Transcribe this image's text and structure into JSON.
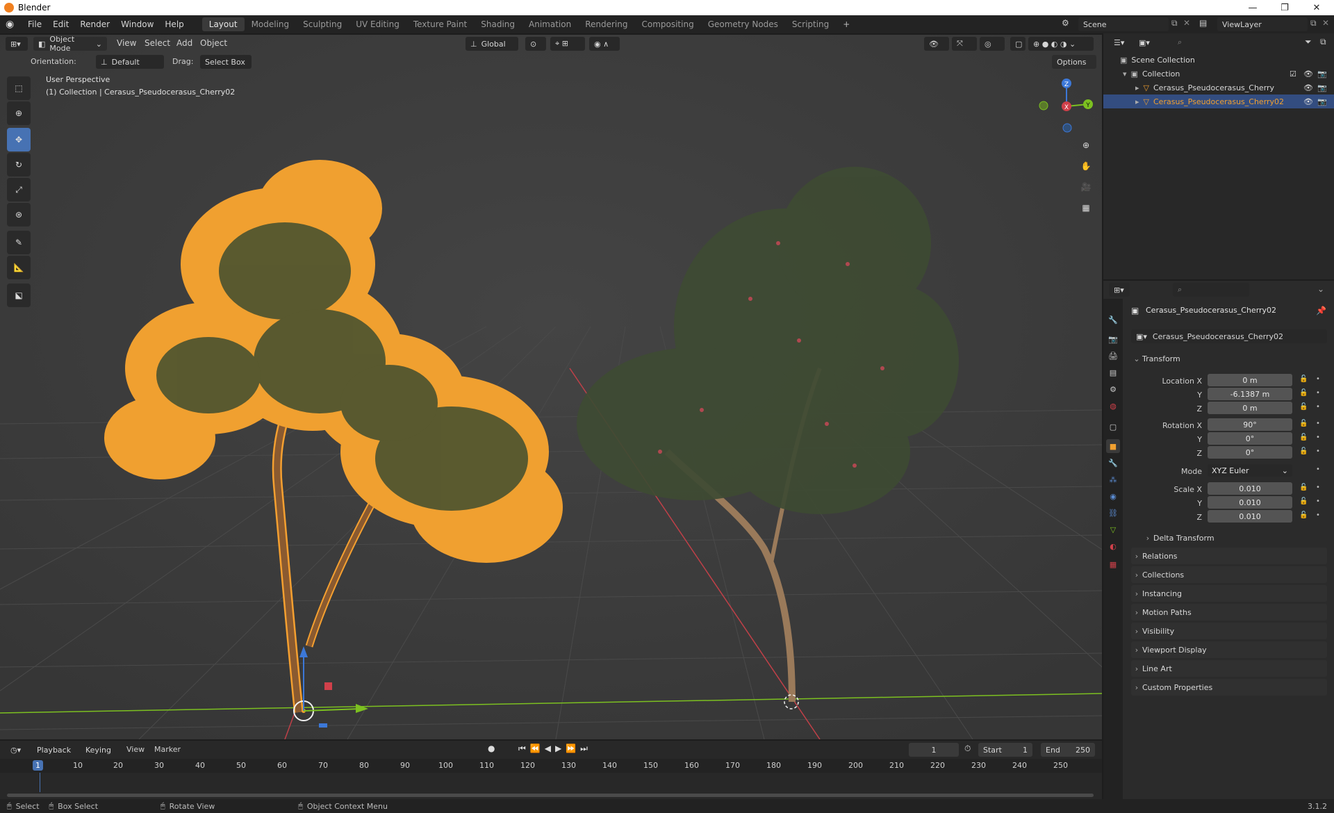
{
  "window": {
    "title": "Blender",
    "minimize": "—",
    "restore": "❐",
    "close": "✕"
  },
  "menu": [
    "File",
    "Edit",
    "Render",
    "Window",
    "Help"
  ],
  "workspaces": [
    "Layout",
    "Modeling",
    "Sculpting",
    "UV Editing",
    "Texture Paint",
    "Shading",
    "Animation",
    "Rendering",
    "Compositing",
    "Geometry Nodes",
    "Scripting"
  ],
  "active_workspace": "Layout",
  "scene": {
    "label": "Scene",
    "view_layer": "ViewLayer"
  },
  "viewport_header": {
    "mode": "Object Mode",
    "menus": [
      "View",
      "Select",
      "Add",
      "Object"
    ],
    "transform_orientation": "Global",
    "options": "Options"
  },
  "tool_settings": {
    "orientation_label": "Orientation:",
    "orientation_value": "Default",
    "drag_label": "Drag:",
    "drag_value": "Select Box"
  },
  "viewport_info": {
    "line1": "User Perspective",
    "line2": "(1) Collection | Cerasus_Pseudocerasus_Cherry02"
  },
  "gizmo": {
    "x": "X",
    "y": "Y",
    "z": "Z"
  },
  "outliner": {
    "scene_collection": "Scene Collection",
    "collection": "Collection",
    "items": [
      "Cerasus_Pseudocerasus_Cherry",
      "Cerasus_Pseudocerasus_Cherry02"
    ],
    "selected_index": 1
  },
  "properties": {
    "object_name": "Cerasus_Pseudocerasus_Cherry02",
    "object_field": "Cerasus_Pseudocerasus_Cherry02",
    "transform_title": "Transform",
    "location": {
      "label": "Location X",
      "x": "0 m",
      "y": "-6.1387 m",
      "z": "0 m"
    },
    "rotation": {
      "label": "Rotation X",
      "x": "90°",
      "y": "0°",
      "z": "0°"
    },
    "mode": {
      "label": "Mode",
      "value": "XYZ Euler"
    },
    "scale": {
      "label": "Scale X",
      "x": "0.010",
      "y": "0.010",
      "z": "0.010"
    },
    "axis_y": "Y",
    "axis_z": "Z",
    "delta_transform": "Delta Transform",
    "panels": [
      "Relations",
      "Collections",
      "Instancing",
      "Motion Paths",
      "Visibility",
      "Viewport Display",
      "Line Art",
      "Custom Properties"
    ]
  },
  "timeline": {
    "menus": [
      "Playback",
      "Keying",
      "View",
      "Marker"
    ],
    "current_frame": "1",
    "start_label": "Start",
    "start": "1",
    "end_label": "End",
    "end": "250",
    "ticks": [
      "1",
      "10",
      "20",
      "30",
      "40",
      "50",
      "60",
      "70",
      "80",
      "90",
      "100",
      "110",
      "120",
      "130",
      "140",
      "150",
      "160",
      "170",
      "180",
      "190",
      "200",
      "210",
      "220",
      "230",
      "240",
      "250"
    ]
  },
  "statusbar": {
    "select": "Select",
    "box_select": "Box Select",
    "rotate_view": "Rotate View",
    "context_menu": "Object Context Menu",
    "version": "3.1.2"
  },
  "colors": {
    "selection_outline": "#f5a030",
    "active_tool": "#4772b3",
    "outliner_selected": "#334d80",
    "axis_x": "#d0404a",
    "axis_y": "#7cc020",
    "axis_z": "#3c78d8"
  }
}
